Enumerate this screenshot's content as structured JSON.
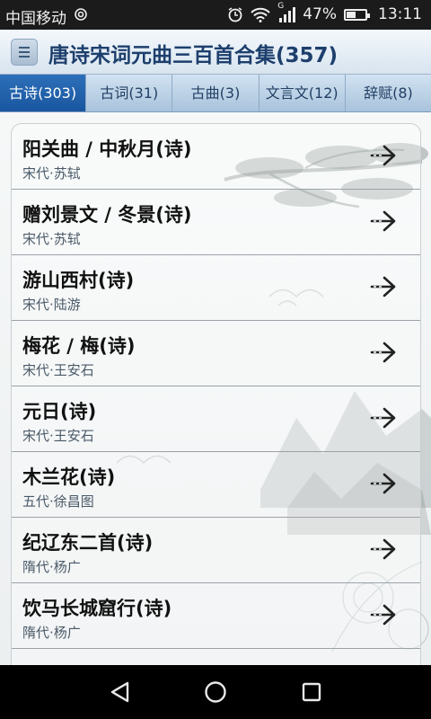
{
  "status_bar": {
    "carrier": "中国移动",
    "network_type": "G",
    "battery": "47%",
    "battery_level": 0.47,
    "time": "13:11"
  },
  "title_bar": {
    "title": "唐诗宋词元曲三百首合集(357)"
  },
  "tabs": [
    {
      "label": "古诗(303)",
      "active": true
    },
    {
      "label": "古词(31)",
      "active": false
    },
    {
      "label": "古曲(3)",
      "active": false
    },
    {
      "label": "文言文(12)",
      "active": false
    },
    {
      "label": "辞赋(8)",
      "active": false
    }
  ],
  "poems": [
    {
      "title": "阳关曲 / 中秋月(诗)",
      "author": "宋代·苏轼"
    },
    {
      "title": "赠刘景文 / 冬景(诗)",
      "author": "宋代·苏轼"
    },
    {
      "title": "游山西村(诗)",
      "author": "宋代·陆游"
    },
    {
      "title": "梅花 / 梅(诗)",
      "author": "宋代·王安石"
    },
    {
      "title": "元日(诗)",
      "author": "宋代·王安石"
    },
    {
      "title": "木兰花(诗)",
      "author": "五代·徐昌图"
    },
    {
      "title": "纪辽东二首(诗)",
      "author": "隋代·杨广"
    },
    {
      "title": "饮马长城窟行(诗)",
      "author": "隋代·杨广"
    }
  ],
  "icons": {
    "row_action": "arrow-right-icon",
    "nav_back": "back-triangle-icon",
    "nav_home": "home-circle-icon",
    "nav_recents": "recents-square-icon"
  },
  "colors": {
    "active_tab": "#1f5fa8",
    "title_text": "#1d3f6d"
  }
}
